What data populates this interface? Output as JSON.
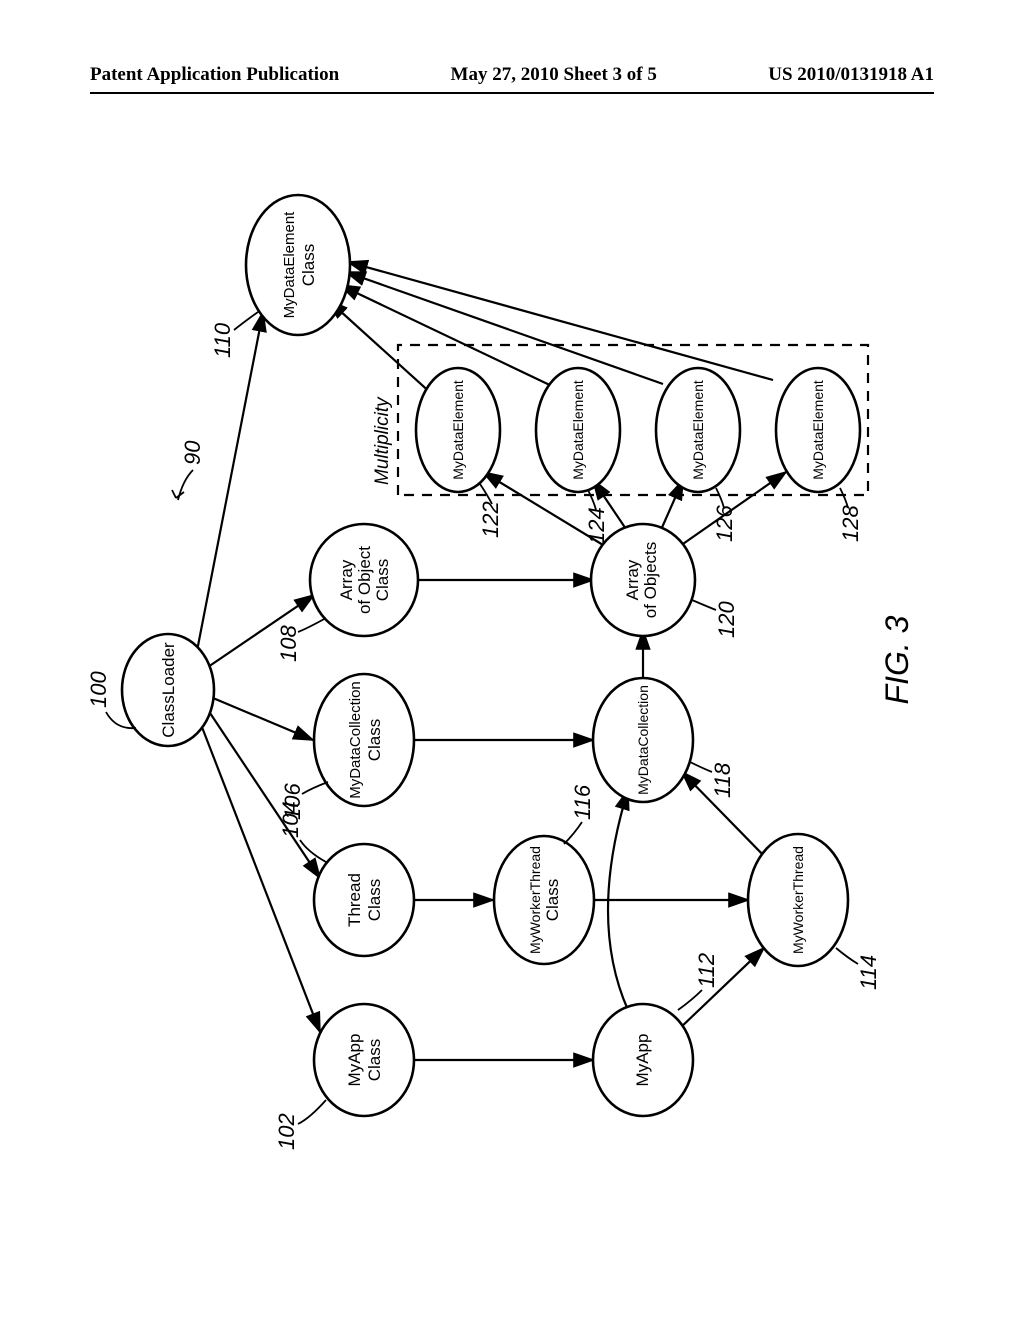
{
  "header": {
    "left": "Patent Application Publication",
    "center": "May 27, 2010  Sheet 3 of 5",
    "right": "US 2010/0131918 A1"
  },
  "figure": {
    "label": "FIG. 3",
    "overall_ref": "90",
    "group_label": "Multiplicity"
  },
  "nodes": {
    "n100": {
      "label1": "ClassLoader",
      "ref": "100"
    },
    "n102": {
      "label1": "MyApp",
      "label2": "Class",
      "ref": "102"
    },
    "n104": {
      "label1": "Thread",
      "label2": "Class",
      "ref": "104"
    },
    "n106": {
      "label1": "MyDataCollection",
      "label2": "Class",
      "ref": "106"
    },
    "n108": {
      "label1": "Array",
      "label2": "of Object",
      "label3": "Class",
      "ref": "108"
    },
    "n110": {
      "label1": "MyDataElement",
      "label2": "Class",
      "ref": "110"
    },
    "n112": {
      "label1": "MyApp",
      "ref": "112"
    },
    "n114": {
      "label1": "MyWorkerThread",
      "ref": "114"
    },
    "n116": {
      "label1": "MyWorkerThread",
      "label2": "Class",
      "ref": "116"
    },
    "n118": {
      "label1": "MyDataCollection",
      "ref": "118"
    },
    "n120": {
      "label1": "Array",
      "label2": "of Objects",
      "ref": "120"
    },
    "n122": {
      "label1": "MyDataElement",
      "ref": "122"
    },
    "n124": {
      "label1": "MyDataElement",
      "ref": "124"
    },
    "n126": {
      "label1": "MyDataElement",
      "ref": "126"
    },
    "n128": {
      "label1": "MyDataElement",
      "ref": "128"
    }
  }
}
